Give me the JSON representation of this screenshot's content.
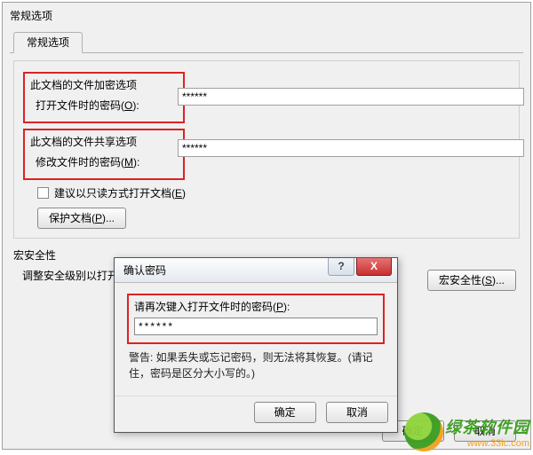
{
  "window": {
    "title": "常规选项",
    "tab": "常规选项"
  },
  "sections": {
    "encrypt": {
      "title": "此文档的文件加密选项",
      "open_label_pre": "打开文件时的密码(",
      "open_hotkey": "O",
      "open_label_post": "):",
      "open_value": "******"
    },
    "share": {
      "title": "此文档的文件共享选项",
      "modify_label_pre": "修改文件时的密码(",
      "modify_hotkey": "M",
      "modify_label_post": "):",
      "modify_value": "******"
    },
    "readonly": {
      "label_pre": "建议以只读方式打开文档(",
      "hotkey": "E",
      "label_post": ")"
    },
    "protect": {
      "label_pre": "保护文档(",
      "hotkey": "P",
      "label_post": ")..."
    }
  },
  "macro": {
    "title": "宏安全性",
    "desc": "调整安全级别以打开可能包含宏病毒的文件，并指定可信任的宏创建者姓名。",
    "button_pre": "宏安全性(",
    "button_hotkey": "S",
    "button_post": ")..."
  },
  "buttons": {
    "ok": "确定",
    "cancel": "取消"
  },
  "dialog": {
    "title": "确认密码",
    "help": "?",
    "close": "X",
    "label_pre": "请再次键入打开文件时的密码(",
    "label_hotkey": "P",
    "label_post": "):",
    "value": "******",
    "warning": "警告: 如果丢失或忘记密码，则无法将其恢复。(请记住，密码是区分大小写的。)",
    "ok": "确定",
    "cancel": "取消"
  },
  "watermark": {
    "brand": "绿茶软件园",
    "url": "www.33lc.com"
  }
}
